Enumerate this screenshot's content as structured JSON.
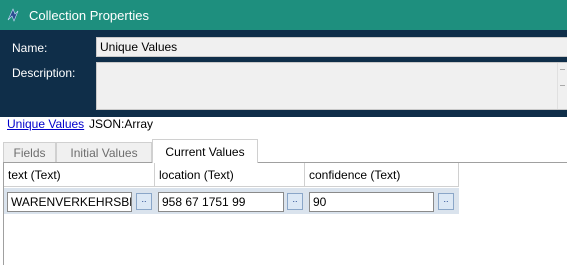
{
  "window": {
    "title": "Collection Properties"
  },
  "properties": {
    "name_label": "Name:",
    "name_value": "Unique Values",
    "description_label": "Description:",
    "description_value": ""
  },
  "collection": {
    "link_text": "Unique Values",
    "type_text": "JSON:Array"
  },
  "tabs": [
    {
      "label": "Fields",
      "active": false
    },
    {
      "label": "Initial Values",
      "active": false
    },
    {
      "label": "Current Values",
      "active": true
    }
  ],
  "grid": {
    "columns": [
      "text  (Text)",
      "location  (Text)",
      "confidence  (Text)"
    ],
    "rows": [
      {
        "text": "WARENVERKEHRSBES",
        "location": "958 67 1751 99",
        "confidence": "90"
      }
    ],
    "button_label": ".."
  },
  "colors": {
    "titlebar": "#1e8f7e",
    "properties_panel": "#0f2e49",
    "row_highlight": "#dae3ed",
    "link": "#0000cc"
  }
}
